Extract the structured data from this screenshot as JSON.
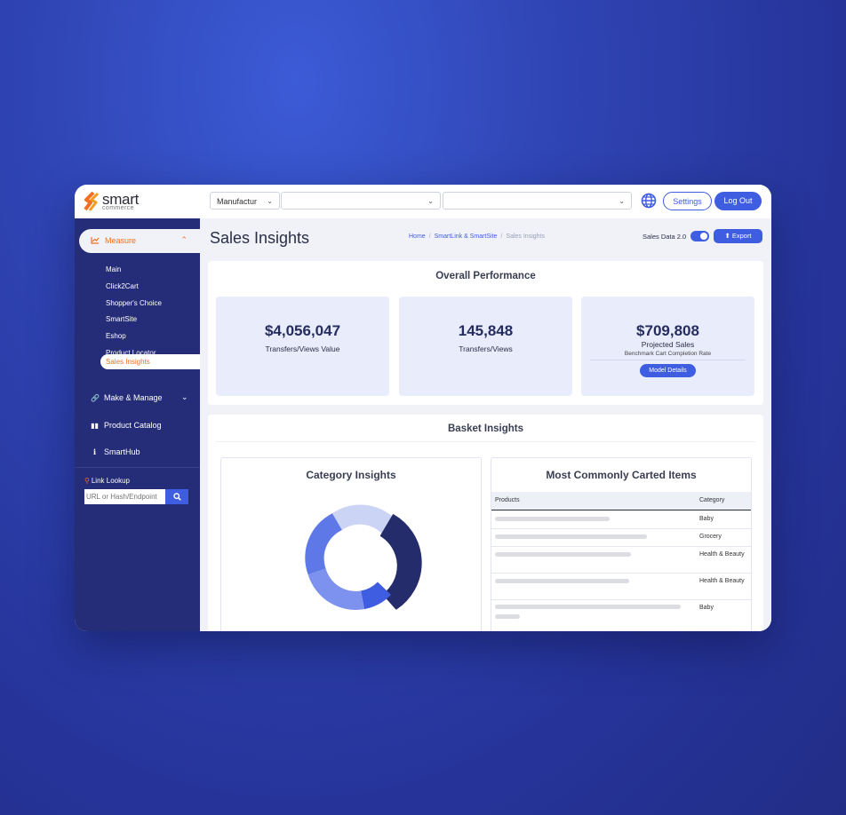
{
  "brand": {
    "name": "smart",
    "sub": "commerce"
  },
  "topbar": {
    "select1": "Manufactur",
    "select2": "",
    "select3": "",
    "settings_label": "Settings",
    "logout_label": "Log Out"
  },
  "sidebar": {
    "measure_label": "Measure",
    "sub_items": [
      "Main",
      "Click2Cart",
      "Shopper's Choice",
      "SmartSite",
      "Eshop",
      "Product Locator",
      "Sales Insights"
    ],
    "items": [
      {
        "label": "Make & Manage",
        "icon": "link-icon"
      },
      {
        "label": "Product Catalog",
        "icon": "book-icon"
      },
      {
        "label": "SmartHub",
        "icon": "info-icon"
      }
    ],
    "lookup_title": "Link Lookup",
    "lookup_placeholder": "URL or Hash/Endpoint"
  },
  "header": {
    "title": "Sales Insights",
    "breadcrumb": [
      "Home",
      "SmartLink & SmartSite",
      "Sales Insights"
    ],
    "sales_data_label": "Sales Data 2.0",
    "sales_data_enabled": true,
    "export_label": "Export"
  },
  "overall": {
    "title": "Overall Performance",
    "kpis": [
      {
        "value": "$4,056,047",
        "label": "Transfers/Views Value"
      },
      {
        "value": "145,848",
        "label": "Transfers/Views"
      },
      {
        "value": "$709,808",
        "label": "Projected Sales",
        "sub": "Benchmark Cart Completion Rate",
        "button": "Model Details"
      }
    ]
  },
  "basket": {
    "title": "Basket Insights",
    "category_title": "Category Insights",
    "carted_title": "Most Commonly Carted Items",
    "columns": [
      "Products",
      "Category"
    ],
    "rows": [
      {
        "category": "Baby",
        "bar_fraction": 0.58
      },
      {
        "category": "Grocery",
        "bar_fraction": 0.77
      },
      {
        "category": "Health & Beauty",
        "bar_fraction": 0.69
      },
      {
        "category": "Health & Beauty",
        "bar_fraction": 0.68
      },
      {
        "category": "Baby",
        "bar_fraction": 0.94
      }
    ]
  },
  "colors": {
    "accent": "#3f5de0",
    "orange": "#f36f21",
    "sidebar": "#252c78",
    "navy": "#252c5e"
  }
}
